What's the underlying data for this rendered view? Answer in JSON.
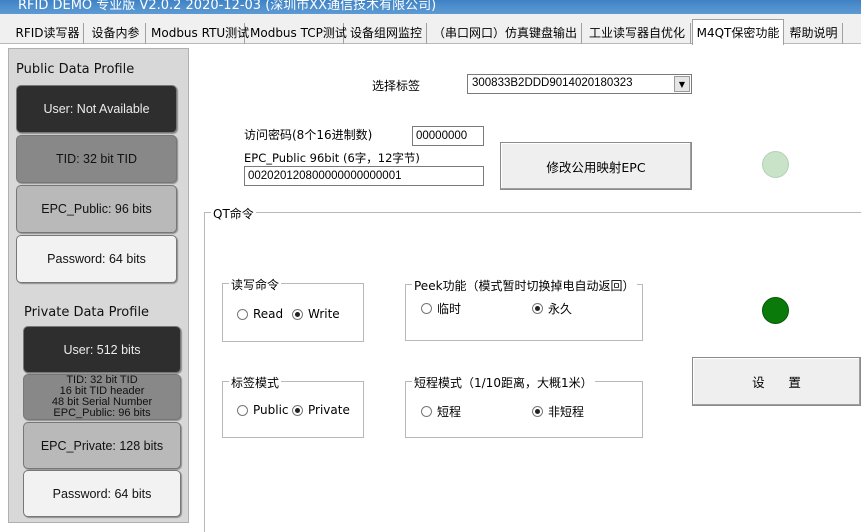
{
  "window": {
    "title": "RFID DEMO 专业版 V2.0.2 2020-12-03 (深圳市XX通信技术有限公司)"
  },
  "tabs": [
    {
      "label": "RFID读写器"
    },
    {
      "label": "设备内参"
    },
    {
      "label": "Modbus RTU测试"
    },
    {
      "label": "Modbus TCP测试"
    },
    {
      "label": "设备组网监控"
    },
    {
      "label": "（串口网口）仿真键盘输出"
    },
    {
      "label": "工业读写器自优化"
    },
    {
      "label": "M4QT保密功能"
    },
    {
      "label": "帮助说明"
    }
  ],
  "public_profile": {
    "title": "Public Data  Profile",
    "user": "User: Not Available",
    "tid": "TID: 32 bit TID",
    "epc_public": "EPC_Public: 96 bits",
    "password": "Password: 64 bits"
  },
  "private_profile": {
    "title": "Private Data  Profile",
    "user": "User: 512 bits",
    "tid_lines": [
      "TID: 32 bit TID",
      "16 bit TID header",
      "48 bit Serial Number",
      "EPC_Public: 96 bits"
    ],
    "epc_private": "EPC_Private: 128 bits",
    "password": "Password: 64 bits"
  },
  "tag_select": {
    "label": "选择标签",
    "value": "300833B2DDD9014020180323"
  },
  "access_password": {
    "label": "访问密码(8个16进制数)",
    "value": "00000000"
  },
  "epc_public_field": {
    "label": "EPC_Public  96bit (6字，12字节)",
    "value": "002020120800000000000001"
  },
  "modify_button": {
    "label": "修改公用映射EPC"
  },
  "qt_group": {
    "title": "QT命令"
  },
  "rw_group": {
    "title": "读写命令",
    "opt_read": "Read",
    "opt_write": "Write",
    "selected": "Write"
  },
  "peek_group": {
    "title": "Peek功能（模式暂时切换掉电自动返回）",
    "opt_temp": "临时",
    "opt_perm": "永久",
    "selected": "永久"
  },
  "mode_group": {
    "title": "标签模式",
    "opt_public": "Public",
    "opt_private": "Private",
    "selected": "Private"
  },
  "range_group": {
    "title": "短程模式（1/10距离，大概1米）",
    "opt_short": "短程",
    "opt_nonshort": "非短程",
    "selected": "非短程"
  },
  "set_button": {
    "label": "设      置"
  },
  "colors": {
    "led_top": "#c9e3c9",
    "led_bottom": "#0a7a0a"
  }
}
